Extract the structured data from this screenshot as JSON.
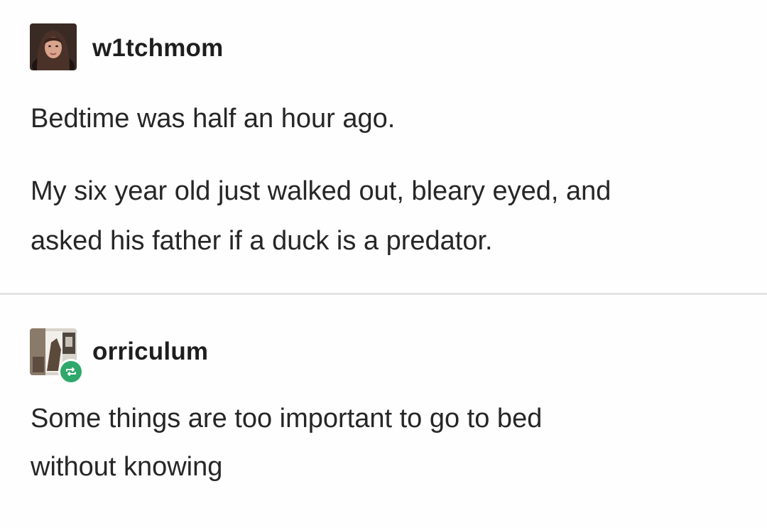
{
  "posts": [
    {
      "username": "w1tchmom",
      "paragraphs": [
        [
          "Bedtime was half an hour ago."
        ],
        [
          "My six year old just walked out, bleary eyed, and",
          "asked his father if a duck is a predator."
        ]
      ]
    },
    {
      "username": "orriculum",
      "reblog_icon": "reblog-icon",
      "paragraphs": [
        [
          "Some things are too important to go to bed",
          "without knowing"
        ]
      ]
    }
  ],
  "colors": {
    "reblog_badge": "#2fa86b",
    "divider": "#e3e3e3",
    "text": "#262626"
  }
}
